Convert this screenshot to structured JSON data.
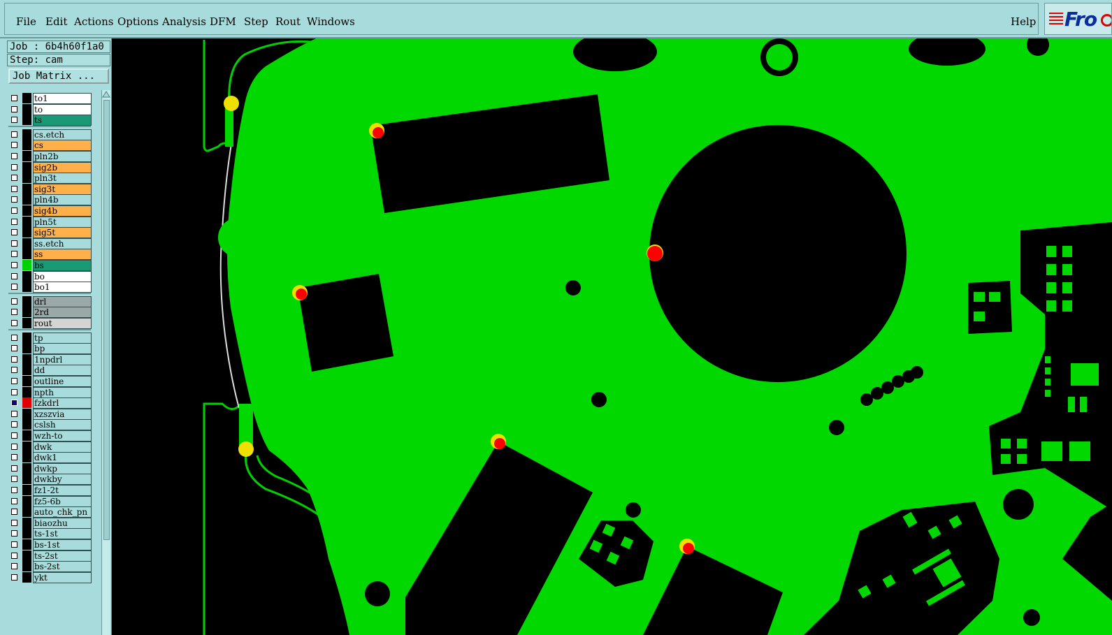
{
  "menubar": {
    "items": [
      "File",
      "Edit",
      "Actions",
      "Options",
      "Analysis",
      "DFM",
      "Step",
      "Rout",
      "Windows"
    ],
    "help": "Help",
    "logo_text": "Fro"
  },
  "job": {
    "job_line": "Job : 6b4h60f1a0",
    "step_line": "Step: cam",
    "matrix_button": "Job Matrix ..."
  },
  "layers": [
    {
      "name": "to1",
      "color": "#ffffff",
      "swatch": "#000000",
      "selected": false
    },
    {
      "name": "to",
      "color": "#ffffff",
      "swatch": "#000000",
      "selected": false
    },
    {
      "name": "ts",
      "color": "#1a9a74",
      "swatch": "#000000",
      "selected": false
    },
    {
      "name": "cs.etch",
      "color": "#a8dcdc",
      "swatch": "#000000",
      "selected": false
    },
    {
      "name": "cs",
      "color": "#ffb04a",
      "swatch": "#000000",
      "selected": false
    },
    {
      "name": "pln2b",
      "color": "#a8dcdc",
      "swatch": "#000000",
      "selected": false
    },
    {
      "name": "sig2b",
      "color": "#ffb04a",
      "swatch": "#000000",
      "selected": false
    },
    {
      "name": "pln3t",
      "color": "#a8dcdc",
      "swatch": "#000000",
      "selected": false
    },
    {
      "name": "sig3t",
      "color": "#ffb04a",
      "swatch": "#000000",
      "selected": false
    },
    {
      "name": "pln4b",
      "color": "#a8dcdc",
      "swatch": "#000000",
      "selected": false
    },
    {
      "name": "sig4b",
      "color": "#ffb04a",
      "swatch": "#000000",
      "selected": false
    },
    {
      "name": "pln5t",
      "color": "#a8dcdc",
      "swatch": "#000000",
      "selected": false
    },
    {
      "name": "sig5t",
      "color": "#ffb04a",
      "swatch": "#000000",
      "selected": false
    },
    {
      "name": "ss.etch",
      "color": "#a8dcdc",
      "swatch": "#000000",
      "selected": false
    },
    {
      "name": "ss",
      "color": "#ffb04a",
      "swatch": "#000000",
      "selected": false
    },
    {
      "name": "bs",
      "color": "#1a9a74",
      "swatch": "#00d000",
      "selected": false
    },
    {
      "name": "bo",
      "color": "#ffffff",
      "swatch": "#000000",
      "selected": false
    },
    {
      "name": "bo1",
      "color": "#ffffff",
      "swatch": "#000000",
      "selected": false
    },
    {
      "name": "drl",
      "color": "#9aa8a8",
      "swatch": "#000000",
      "selected": false
    },
    {
      "name": "2rd",
      "color": "#9aa8a8",
      "swatch": "#000000",
      "selected": false
    },
    {
      "name": "rout",
      "color": "#d4d4d4",
      "swatch": "#000000",
      "selected": false
    },
    {
      "name": "tp",
      "color": "#a8dcdc",
      "swatch": "#000000",
      "selected": false
    },
    {
      "name": "bp",
      "color": "#a8dcdc",
      "swatch": "#000000",
      "selected": false
    },
    {
      "name": "1npdrl",
      "color": "#a8dcdc",
      "swatch": "#000000",
      "selected": false
    },
    {
      "name": "dd",
      "color": "#a8dcdc",
      "swatch": "#000000",
      "selected": false
    },
    {
      "name": "outline",
      "color": "#a8dcdc",
      "swatch": "#000000",
      "selected": false
    },
    {
      "name": "npth",
      "color": "#a8dcdc",
      "swatch": "#000000",
      "selected": false
    },
    {
      "name": "fzkdrl",
      "color": "#a8dcdc",
      "swatch": "#e00000",
      "selected": true
    },
    {
      "name": "xzszvia",
      "color": "#a8dcdc",
      "swatch": "#000000",
      "selected": false
    },
    {
      "name": "cslsh",
      "color": "#a8dcdc",
      "swatch": "#000000",
      "selected": false
    },
    {
      "name": "wzh-to",
      "color": "#a8dcdc",
      "swatch": "#000000",
      "selected": false
    },
    {
      "name": "dwk",
      "color": "#a8dcdc",
      "swatch": "#000000",
      "selected": false
    },
    {
      "name": "dwk1",
      "color": "#a8dcdc",
      "swatch": "#000000",
      "selected": false
    },
    {
      "name": "dwkp",
      "color": "#a8dcdc",
      "swatch": "#000000",
      "selected": false
    },
    {
      "name": "dwkby",
      "color": "#a8dcdc",
      "swatch": "#000000",
      "selected": false
    },
    {
      "name": "fz1-2t",
      "color": "#a8dcdc",
      "swatch": "#000000",
      "selected": false
    },
    {
      "name": "fz5-6b",
      "color": "#a8dcdc",
      "swatch": "#000000",
      "selected": false
    },
    {
      "name": "auto_chk_pn",
      "color": "#a8dcdc",
      "swatch": "#000000",
      "selected": false
    },
    {
      "name": "biaozhu",
      "color": "#a8dcdc",
      "swatch": "#000000",
      "selected": false
    },
    {
      "name": "ts-1st",
      "color": "#a8dcdc",
      "swatch": "#000000",
      "selected": false
    },
    {
      "name": "bs-1st",
      "color": "#a8dcdc",
      "swatch": "#000000",
      "selected": false
    },
    {
      "name": "ts-2st",
      "color": "#a8dcdc",
      "swatch": "#000000",
      "selected": false
    },
    {
      "name": "bs-2st",
      "color": "#a8dcdc",
      "swatch": "#000000",
      "selected": false
    },
    {
      "name": "ykt",
      "color": "#a8dcdc",
      "swatch": "#000000",
      "selected": false
    }
  ],
  "colors": {
    "copper": "#00d800",
    "background": "#000000",
    "marker_outer": "#f0e000",
    "marker_inner": "#ff0000",
    "panel": "#a8dcdc"
  }
}
